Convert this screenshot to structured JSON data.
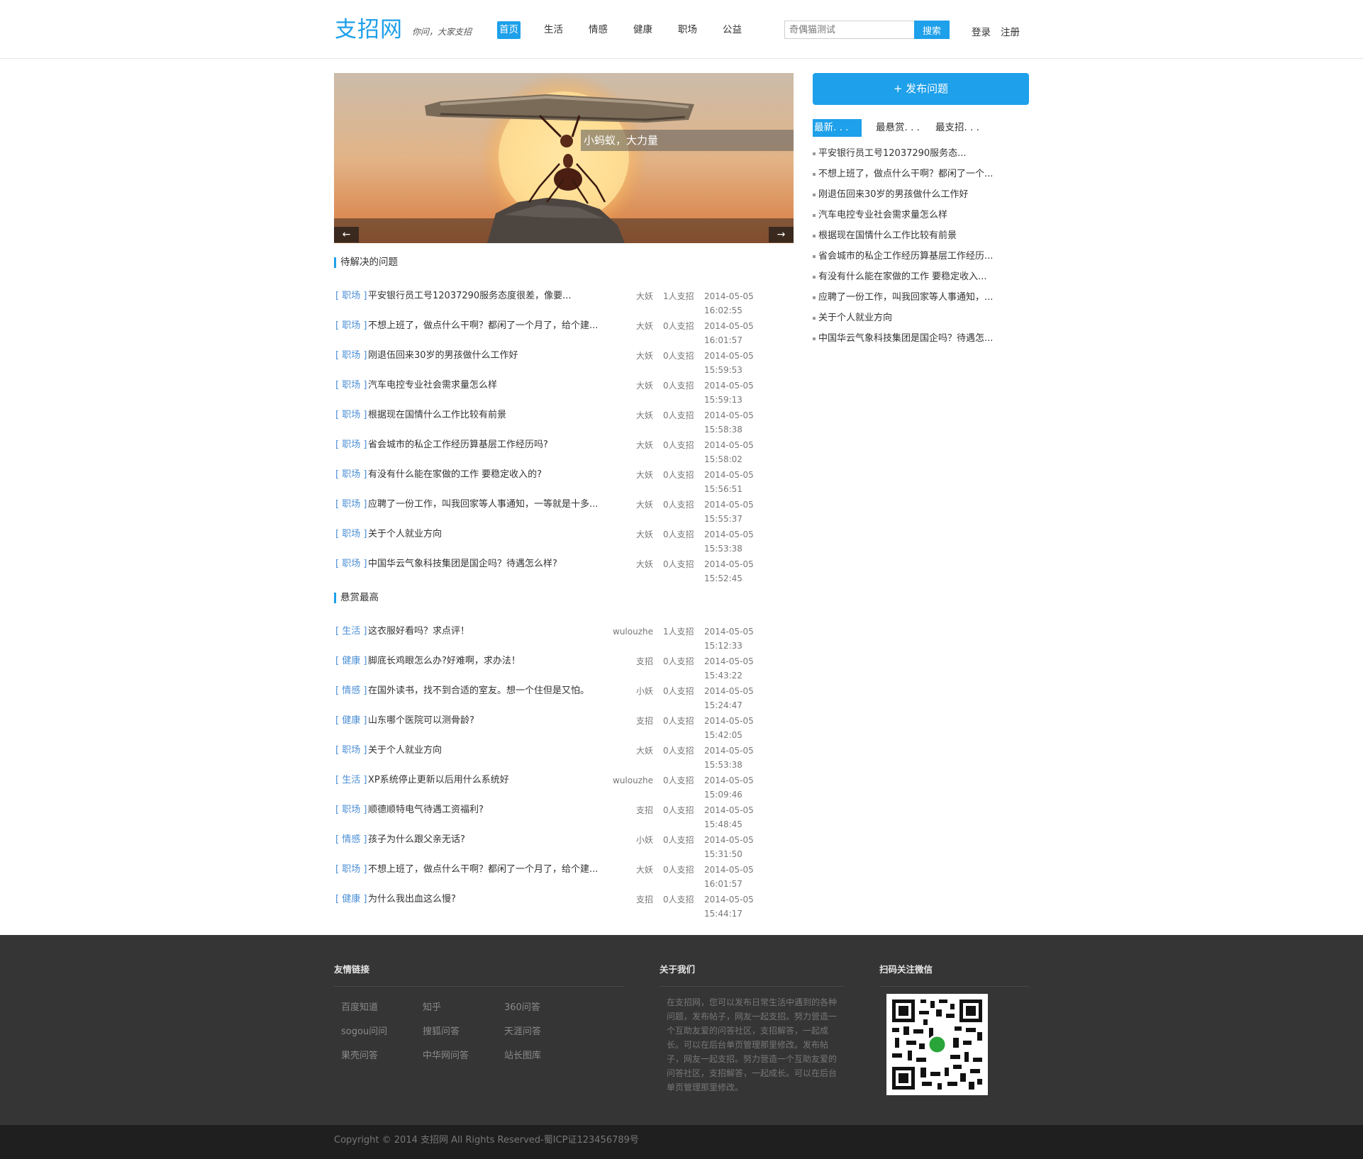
{
  "header": {
    "logo": "支招网",
    "slogan": "你问，大家支招",
    "nav": [
      "首页",
      "生活",
      "情感",
      "健康",
      "职场",
      "公益"
    ],
    "search_placeholder": "奇偶猫测试",
    "search_button": "搜索",
    "login": "登录",
    "register": "注册"
  },
  "banner": {
    "caption": "小蚂蚁，大力量",
    "prev_arrow": "←",
    "next_arrow": "→"
  },
  "pending": {
    "title": "待解决的问题",
    "items": [
      {
        "cat": "[ 职场 ]",
        "title": "平安银行员工号12037290服务态度很差，像要...",
        "author": "大妖",
        "count": "1人支招",
        "time": "2014-05-05 16:02:55"
      },
      {
        "cat": "[ 职场 ]",
        "title": "不想上班了，做点什么干啊？都闲了一个月了，给个建...",
        "author": "大妖",
        "count": "0人支招",
        "time": "2014-05-05 16:01:57"
      },
      {
        "cat": "[ 职场 ]",
        "title": "刚退伍回来30岁的男孩做什么工作好",
        "author": "大妖",
        "count": "0人支招",
        "time": "2014-05-05 15:59:53"
      },
      {
        "cat": "[ 职场 ]",
        "title": "汽车电控专业社会需求量怎么样",
        "author": "大妖",
        "count": "0人支招",
        "time": "2014-05-05 15:59:13"
      },
      {
        "cat": "[ 职场 ]",
        "title": "根据现在国情什么工作比较有前景",
        "author": "大妖",
        "count": "0人支招",
        "time": "2014-05-05 15:58:38"
      },
      {
        "cat": "[ 职场 ]",
        "title": "省会城市的私企工作经历算基层工作经历吗?",
        "author": "大妖",
        "count": "0人支招",
        "time": "2014-05-05 15:58:02"
      },
      {
        "cat": "[ 职场 ]",
        "title": "有没有什么能在家做的工作 要稳定收入的?",
        "author": "大妖",
        "count": "0人支招",
        "time": "2014-05-05 15:56:51"
      },
      {
        "cat": "[ 职场 ]",
        "title": "应聘了一份工作，叫我回家等人事通知，一等就是十多...",
        "author": "大妖",
        "count": "0人支招",
        "time": "2014-05-05 15:55:37"
      },
      {
        "cat": "[ 职场 ]",
        "title": "关于个人就业方向",
        "author": "大妖",
        "count": "0人支招",
        "time": "2014-05-05 15:53:38"
      },
      {
        "cat": "[ 职场 ]",
        "title": "中国华云气象科技集团是国企吗？待遇怎么样?",
        "author": "大妖",
        "count": "0人支招",
        "time": "2014-05-05 15:52:45"
      }
    ]
  },
  "reward": {
    "title": "悬赏最高",
    "items": [
      {
        "cat": "[ 生活 ]",
        "title": "这衣服好看吗？求点评！",
        "author": "wulouzhe",
        "count": "1人支招",
        "time": "2014-05-05 15:12:33"
      },
      {
        "cat": "[ 健康 ]",
        "title": "脚底长鸡眼怎么办?好难啊，求办法！",
        "author": "支招",
        "count": "0人支招",
        "time": "2014-05-05 15:43:22"
      },
      {
        "cat": "[ 情感 ]",
        "title": "在国外读书，找不到合适的室友。想一个住但是又怕。",
        "author": "小妖",
        "count": "0人支招",
        "time": "2014-05-05 15:24:47"
      },
      {
        "cat": "[ 健康 ]",
        "title": "山东哪个医院可以测骨龄?",
        "author": "支招",
        "count": "0人支招",
        "time": "2014-05-05 15:42:05"
      },
      {
        "cat": "[ 职场 ]",
        "title": "关于个人就业方向",
        "author": "大妖",
        "count": "0人支招",
        "time": "2014-05-05 15:53:38"
      },
      {
        "cat": "[ 生活 ]",
        "title": "XP系统停止更新以后用什么系统好",
        "author": "wulouzhe",
        "count": "0人支招",
        "time": "2014-05-05 15:09:46"
      },
      {
        "cat": "[ 职场 ]",
        "title": "顺德顺特电气待遇工资福利?",
        "author": "支招",
        "count": "0人支招",
        "time": "2014-05-05 15:48:45"
      },
      {
        "cat": "[ 情感 ]",
        "title": "孩子为什么跟父亲无话?",
        "author": "小妖",
        "count": "0人支招",
        "time": "2014-05-05 15:31:50"
      },
      {
        "cat": "[ 职场 ]",
        "title": "不想上班了，做点什么干啊？都闲了一个月了，给个建...",
        "author": "大妖",
        "count": "0人支招",
        "time": "2014-05-05 16:01:57"
      },
      {
        "cat": "[ 健康 ]",
        "title": "为什么我出血这么慢?",
        "author": "支招",
        "count": "0人支招",
        "time": "2014-05-05 15:44:17"
      }
    ]
  },
  "sidebar": {
    "publish_button": "+ 发布问题",
    "tabs": [
      "最新. . .",
      "最悬赏. . .",
      "最支招. . ."
    ],
    "items": [
      "平安银行员工号12037290服务态...",
      "不想上班了，做点什么干啊？都闲了一个...",
      "刚退伍回来30岁的男孩做什么工作好",
      "汽车电控专业社会需求量怎么样",
      "根据现在国情什么工作比较有前景",
      "省会城市的私企工作经历算基层工作经历...",
      "有没有什么能在家做的工作 要稳定收入...",
      "应聘了一份工作，叫我回家等人事通知，...",
      "关于个人就业方向",
      "中国华云气象科技集团是国企吗？待遇怎..."
    ]
  },
  "footer": {
    "links_title": "友情链接",
    "links": [
      "百度知道",
      "知乎",
      "360问答",
      "sogou问问",
      "搜狐问答",
      "天涯问答",
      "果壳问答",
      "中华网问答",
      "站长图库"
    ],
    "about_title": "关于我们",
    "about_text": "在支招网，您可以发布日常生活中遇到的各种问题，发布帖子，网友一起支招。努力营造一个互助友爱的问答社区，支招解答，一起成长。可以在后台单页管理那里修改。发布帖子，网友一起支招。努力营造一个互助友爱的问答社区，支招解答，一起成长。可以在后台单页管理那里修改。",
    "wechat_title": "扫码关注微信",
    "copyright": "Copyright © 2014 支招网 All Rights Reserved-蜀ICP证123456789号"
  },
  "colors": {
    "accent": "#1ea0ea",
    "footer_bg": "#353535",
    "copyright_bg": "#1f1f1f"
  }
}
